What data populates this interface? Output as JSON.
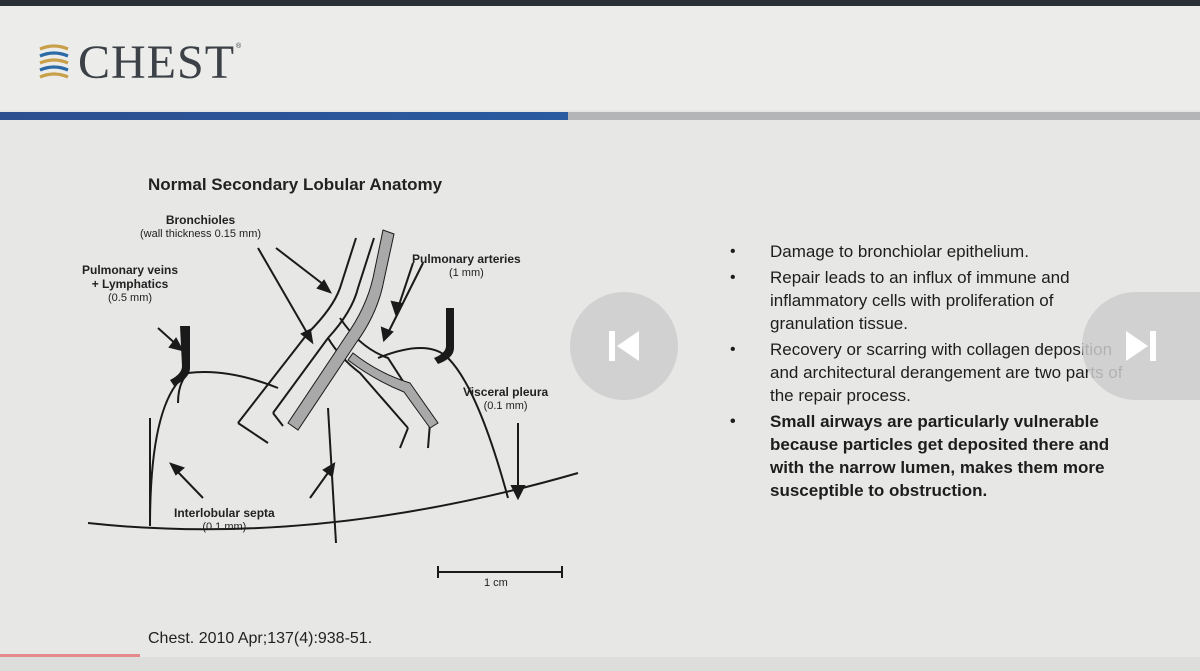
{
  "header": {
    "logo_text": "CHEST",
    "logo_mark_icon": "chest-journal-logo-mark",
    "trademark": "®"
  },
  "colors": {
    "accent_blue": "#2c4f8f",
    "rule_gray": "#b4b5b6",
    "background": "#e7e7e6",
    "logo_gold": "#c9a04a",
    "logo_blue": "#2b6aa6"
  },
  "figure": {
    "title": "Normal Secondary Lobular Anatomy",
    "labels": {
      "bronchioles": "Bronchioles",
      "bronchioles_note": "(wall thickness 0.15 mm)",
      "pulmonary_veins": "Pulmonary veins",
      "lymphatics": "+ Lymphatics",
      "veins_note": "(0.5 mm)",
      "pulmonary_arteries": "Pulmonary arteries",
      "arteries_note": "(1 mm)",
      "visceral_pleura": "Visceral pleura",
      "pleura_note": "(0.1 mm)",
      "interlobular_septa": "Interlobular septa",
      "septa_note": "(0.1 mm)",
      "scale": "1 cm"
    }
  },
  "bullets": [
    {
      "text": "Damage to bronchiolar epithelium.",
      "bold": false
    },
    {
      "text": " Repair leads to an influx of immune and inflammatory cells with proliferation of granulation tissue.",
      "bold": false
    },
    {
      "text": "Recovery or scarring with collagen deposition and architectural derangement are two parts of the repair process.",
      "bold": false
    },
    {
      "text": "Small airways are particularly vulnerable because particles get deposited there and with the narrow lumen, makes them more susceptible to obstruction.",
      "bold": true
    }
  ],
  "citation": "Chest. 2010 Apr;137(4):938-51.",
  "player": {
    "prev_icon": "skip-previous-icon",
    "next_icon": "skip-next-icon",
    "progress": 0.117
  }
}
